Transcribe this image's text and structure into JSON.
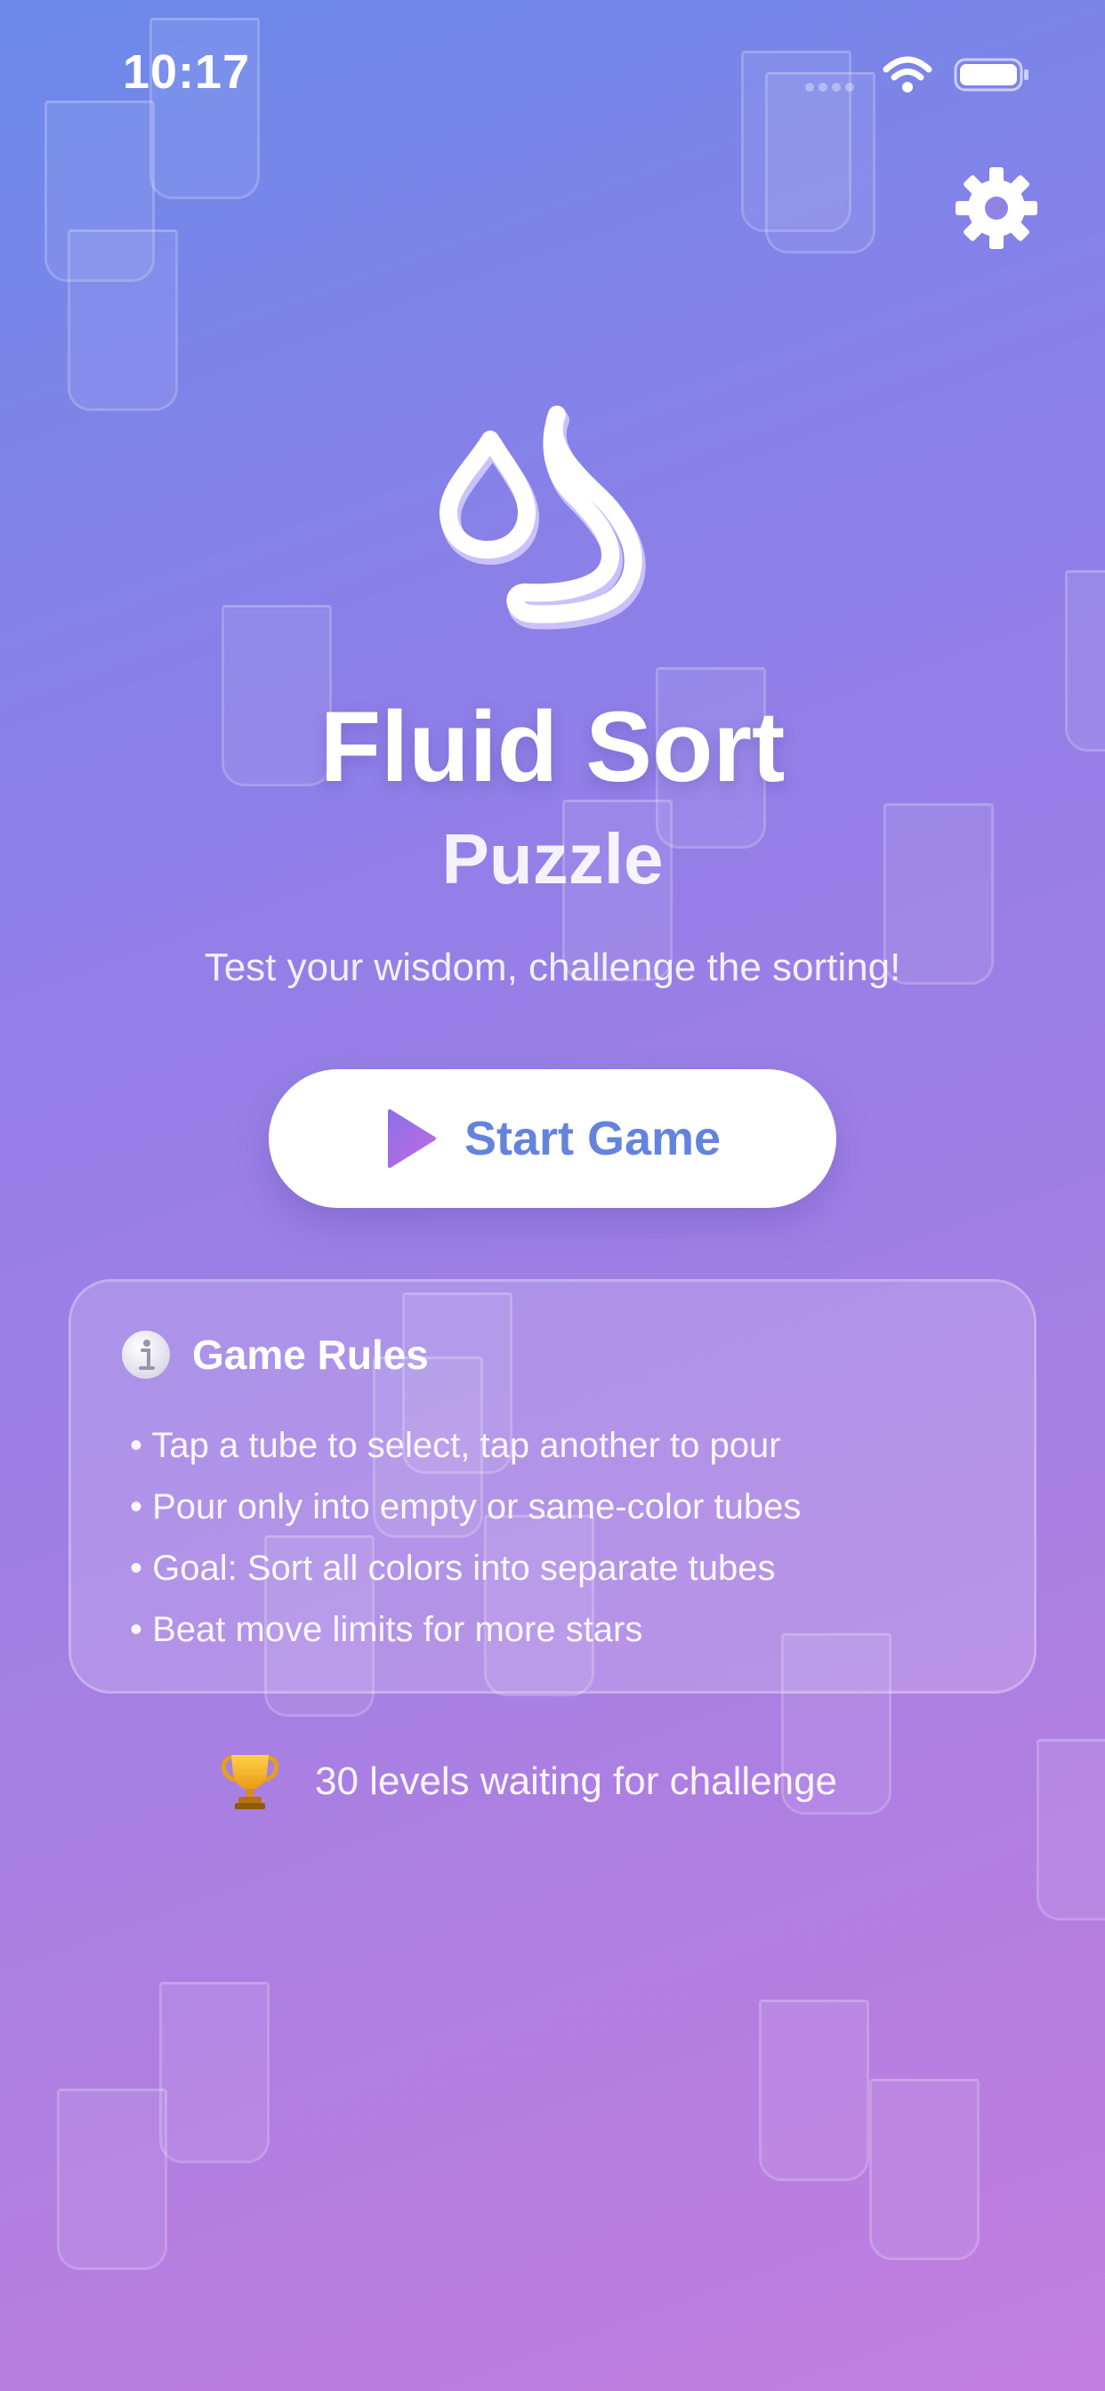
{
  "status_bar": {
    "time": "10:17"
  },
  "header": {
    "settings_icon": "gear-icon"
  },
  "logo": {
    "icon": "droplets-icon"
  },
  "hero": {
    "title": "Fluid Sort",
    "subtitle": "Puzzle",
    "tagline": "Test your wisdom, challenge the sorting!"
  },
  "start_button": {
    "label": "Start Game",
    "icon": "play-icon"
  },
  "rules": {
    "title": "Game Rules",
    "icon": "info-icon",
    "items": [
      "• Tap a tube to select, tap another to pour",
      "• Pour only into empty or same-color tubes",
      "• Goal: Sort all colors into separate tubes",
      "• Beat move limits for more stars"
    ]
  },
  "levels": {
    "icon": "trophy-icon",
    "text": "30 levels waiting for challenge"
  },
  "colors": {
    "gradient_start": "#6b8ae9",
    "gradient_end": "#c27edf",
    "accent_text": "#6483dc",
    "button_bg": "#ffffff"
  }
}
